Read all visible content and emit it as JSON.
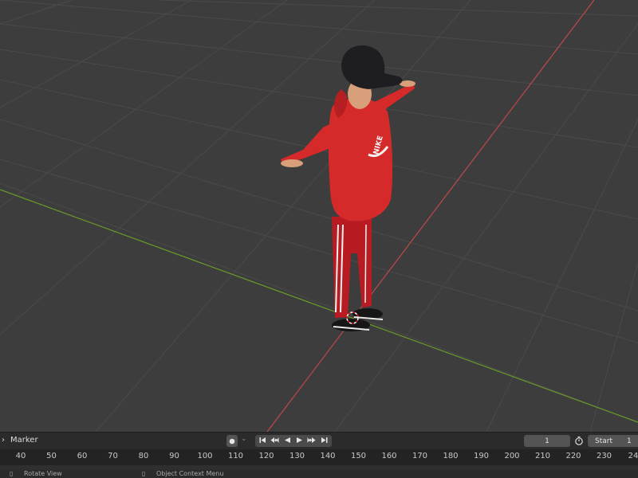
{
  "timeline": {
    "marker_menu": "Marker",
    "current_frame": "1",
    "start_label": "Start",
    "start_value": "1",
    "ruler_ticks": [
      "40",
      "50",
      "60",
      "70",
      "80",
      "90",
      "100",
      "110",
      "120",
      "130",
      "140",
      "150",
      "160",
      "170",
      "180",
      "190",
      "200",
      "210",
      "220",
      "230",
      "24"
    ]
  },
  "playback": {
    "record_icon": "record-icon",
    "jump_start_icon": "jump-to-start-icon",
    "prev_keyframe_icon": "previous-keyframe-icon",
    "play_reverse_icon": "play-reverse-icon",
    "play_icon": "play-icon",
    "next_keyframe_icon": "next-keyframe-icon",
    "jump_end_icon": "jump-to-end-icon"
  },
  "statusbar": {
    "left_hint": "Rotate View",
    "right_hint": "Object Context Menu"
  },
  "scene": {
    "hoodie_logo": "NIKE",
    "colors": {
      "background": "#3d3d3d",
      "grid": "#4a4a4a",
      "x_axis": "#c04848",
      "y_axis": "#6a9a2a",
      "hoodie": "#d62a2a",
      "cap": "#1e1e22"
    }
  }
}
